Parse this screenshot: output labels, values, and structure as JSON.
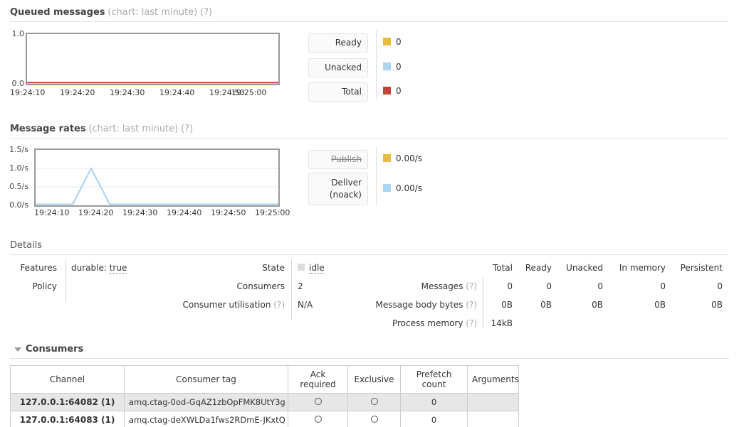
{
  "queued_messages": {
    "title": "Queued messages",
    "subtitle": "(chart: last minute)",
    "help": "(?)",
    "buttons": [
      {
        "label": "Ready",
        "disabled": false
      },
      {
        "label": "Unacked",
        "disabled": false
      },
      {
        "label": "Total",
        "disabled": false
      }
    ],
    "legend": [
      {
        "color": "#e5c037",
        "value": "0"
      },
      {
        "color": "#aed5f2",
        "value": "0"
      },
      {
        "color": "#c3423c",
        "value": "0"
      }
    ]
  },
  "message_rates": {
    "title": "Message rates",
    "subtitle": "(chart: last minute)",
    "help": "(?)",
    "buttons": [
      {
        "label": "Publish",
        "disabled": true
      },
      {
        "label": "Deliver (noack)",
        "disabled": false
      }
    ],
    "legend": [
      {
        "color": "#e5c037",
        "value": "0.00/s"
      },
      {
        "color": "#aed5f2",
        "value": "0.00/s"
      }
    ]
  },
  "details": {
    "title": "Details",
    "left_rows": [
      {
        "label": "Features",
        "value_prefix": "durable: ",
        "value_link": "true"
      },
      {
        "label": "Policy",
        "value_prefix": "",
        "value_link": ""
      }
    ],
    "mid_rows": [
      {
        "label": "State",
        "help": "",
        "value": "idle",
        "has_square": true
      },
      {
        "label": "Consumers",
        "help": "",
        "value": "2",
        "has_square": false
      },
      {
        "label": "Consumer utilisation ",
        "help": "(?)",
        "value": "N/A",
        "has_square": false
      }
    ],
    "stats": {
      "columns": [
        "Total",
        "Ready",
        "Unacked",
        "In memory",
        "Persistent"
      ],
      "rows": [
        {
          "label": "Messages ",
          "help": "(?)",
          "values": [
            "0",
            "0",
            "0",
            "0",
            "0"
          ]
        },
        {
          "label": "Message body bytes ",
          "help": "(?)",
          "values": [
            "0B",
            "0B",
            "0B",
            "0B",
            "0B"
          ]
        },
        {
          "label": "Process memory ",
          "help": "(?)",
          "values": [
            "14kB",
            "",
            "",
            "",
            ""
          ]
        }
      ]
    }
  },
  "consumers": {
    "title": "Consumers",
    "columns": [
      "Channel",
      "Consumer tag",
      "Ack required",
      "Exclusive",
      "Prefetch count",
      "Arguments"
    ],
    "rows": [
      {
        "channel": "127.0.0.1:64082 (1)",
        "consumer_tag": "amq.ctag-0od-GqAZ1zbOpFMK8UtY3g",
        "ack_required": "circle-unchecked",
        "exclusive": "circle-unchecked",
        "prefetch_count": "0",
        "arguments": ""
      },
      {
        "channel": "127.0.0.1:64083 (1)",
        "consumer_tag": "amq.ctag-deXWLDa1fws2RDmE-JKxtQ",
        "ack_required": "circle-unchecked",
        "exclusive": "circle-unchecked",
        "prefetch_count": "0",
        "arguments": ""
      }
    ]
  },
  "chart_data": [
    {
      "type": "line",
      "title": "Queued messages",
      "xlabel": "",
      "ylabel": "",
      "ylim": [
        0.0,
        1.0
      ],
      "yticks": [
        "0.0",
        "1.0"
      ],
      "xticks": [
        "19:24:10",
        "19:24:20",
        "19:24:30",
        "19:24:40",
        "19:24:50",
        "19:25:00"
      ],
      "grid": false,
      "legend_position": "right",
      "series": [
        {
          "name": "Ready",
          "color": "#e5c037",
          "values": [
            0,
            0,
            0,
            0,
            0,
            0,
            0
          ]
        },
        {
          "name": "Unacked",
          "color": "#aed5f2",
          "values": [
            0,
            0,
            0,
            0,
            0,
            0,
            0
          ]
        },
        {
          "name": "Total",
          "color": "#c3423c",
          "values": [
            0,
            0,
            0,
            0,
            0,
            0,
            0
          ]
        }
      ],
      "x": [
        "19:24:05",
        "19:24:15",
        "19:24:25",
        "19:24:35",
        "19:24:45",
        "19:24:55",
        "19:25:05"
      ]
    },
    {
      "type": "line",
      "title": "Message rates",
      "xlabel": "",
      "ylabel": "",
      "ylim": [
        0.0,
        1.5
      ],
      "yticks": [
        "0.0/s",
        "0.5/s",
        "1.0/s",
        "1.5/s"
      ],
      "xticks": [
        "19:24:10",
        "19:24:20",
        "19:24:30",
        "19:24:40",
        "19:24:50",
        "19:25:00"
      ],
      "grid": true,
      "legend_position": "right",
      "series": [
        {
          "name": "Publish",
          "color": "#e5c037",
          "values": [
            0,
            0,
            0,
            0,
            0,
            0,
            0,
            0,
            0,
            0,
            0,
            0,
            0
          ]
        },
        {
          "name": "Deliver (noack)",
          "color": "#aed5f2",
          "values": [
            0,
            0,
            0,
            1.0,
            0,
            0,
            0,
            0,
            0,
            0,
            0,
            0,
            0
          ]
        }
      ],
      "x": [
        "19:24:05",
        "19:24:10",
        "19:24:15",
        "19:24:20",
        "19:24:25",
        "19:24:30",
        "19:24:35",
        "19:24:40",
        "19:24:45",
        "19:24:50",
        "19:24:55",
        "19:25:00",
        "19:25:05"
      ]
    }
  ]
}
